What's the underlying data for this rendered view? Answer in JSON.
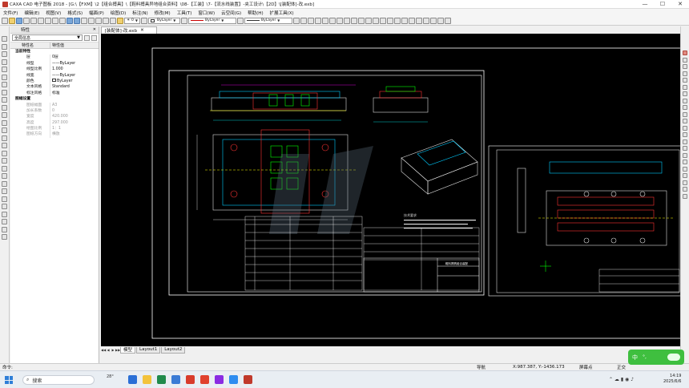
{
  "window": {
    "title": "CAXA CAD 电子图板 2018 - [G:\\【FXM】\\2【组合搏具】\\【鞋料搏具异地组合资料】\\08-【工装】\\7-【流水线装置】-夹工设计\\【2D】\\[装配体]-改.exb]",
    "minimize": "—",
    "maximize": "☐",
    "close": "✕"
  },
  "menu": [
    "文件(F)",
    "编辑(E)",
    "视图(V)",
    "格式(S)",
    "幅面(P)",
    "绘图(D)",
    "标注(N)",
    "修改(M)",
    "工具(T)",
    "窗口(W)",
    "云空间(G)",
    "帮助(H)",
    "扩展工具(X)"
  ],
  "toolbar": {
    "layer_value": "0",
    "linetype_1": "ByLayer",
    "linetype_2": "ByLayer",
    "linetype_3": "ByLayer"
  },
  "properties": {
    "panel_title": "特性",
    "filter_value": "全局信息",
    "col_name": "特性名",
    "col_value": "特性值",
    "rows": [
      {
        "name": "当前特性",
        "value": "",
        "group": true
      },
      {
        "name": "层",
        "value": "0层"
      },
      {
        "name": "线型",
        "value": "——ByLayer"
      },
      {
        "name": "线型比例",
        "value": "1.000"
      },
      {
        "name": "线宽",
        "value": "——ByLayer"
      },
      {
        "name": "颜色",
        "value": "ByLayer",
        "swatch": true
      },
      {
        "name": "文本风格",
        "value": "Standard"
      },
      {
        "name": "标注风格",
        "value": "标准"
      },
      {
        "name": "图幅设置",
        "value": "",
        "group": true
      },
      {
        "name": "图纸幅面",
        "value": "A3",
        "dim": true
      },
      {
        "name": "加长系数",
        "value": "0",
        "dim": true
      },
      {
        "name": "宽度",
        "value": "420.000",
        "dim": true
      },
      {
        "name": "高度",
        "value": "297.000",
        "dim": true
      },
      {
        "name": "绘图比例",
        "value": "1：1",
        "dim": true
      },
      {
        "name": "图纸方向",
        "value": "横放",
        "dim": true
      }
    ]
  },
  "document_tab": {
    "label": "[装配体]-改.exb",
    "close": "✕"
  },
  "layout_tabs": [
    "模型",
    "Layout1",
    "Layout2"
  ],
  "status": {
    "command": "命令:",
    "mode": "导航",
    "coords": "X:987.387, Y:-1436.173",
    "snap": "屏幕点",
    "right": "正交"
  },
  "ime": {
    "label": "中",
    "dots": "°,"
  },
  "taskbar": {
    "search": "搜索",
    "weather": "28°",
    "clock_time": "14:19",
    "clock_date": "2025/6/6"
  },
  "drawing": {
    "table_title": "鞋料搏具组合装配",
    "note": "技术要求"
  }
}
